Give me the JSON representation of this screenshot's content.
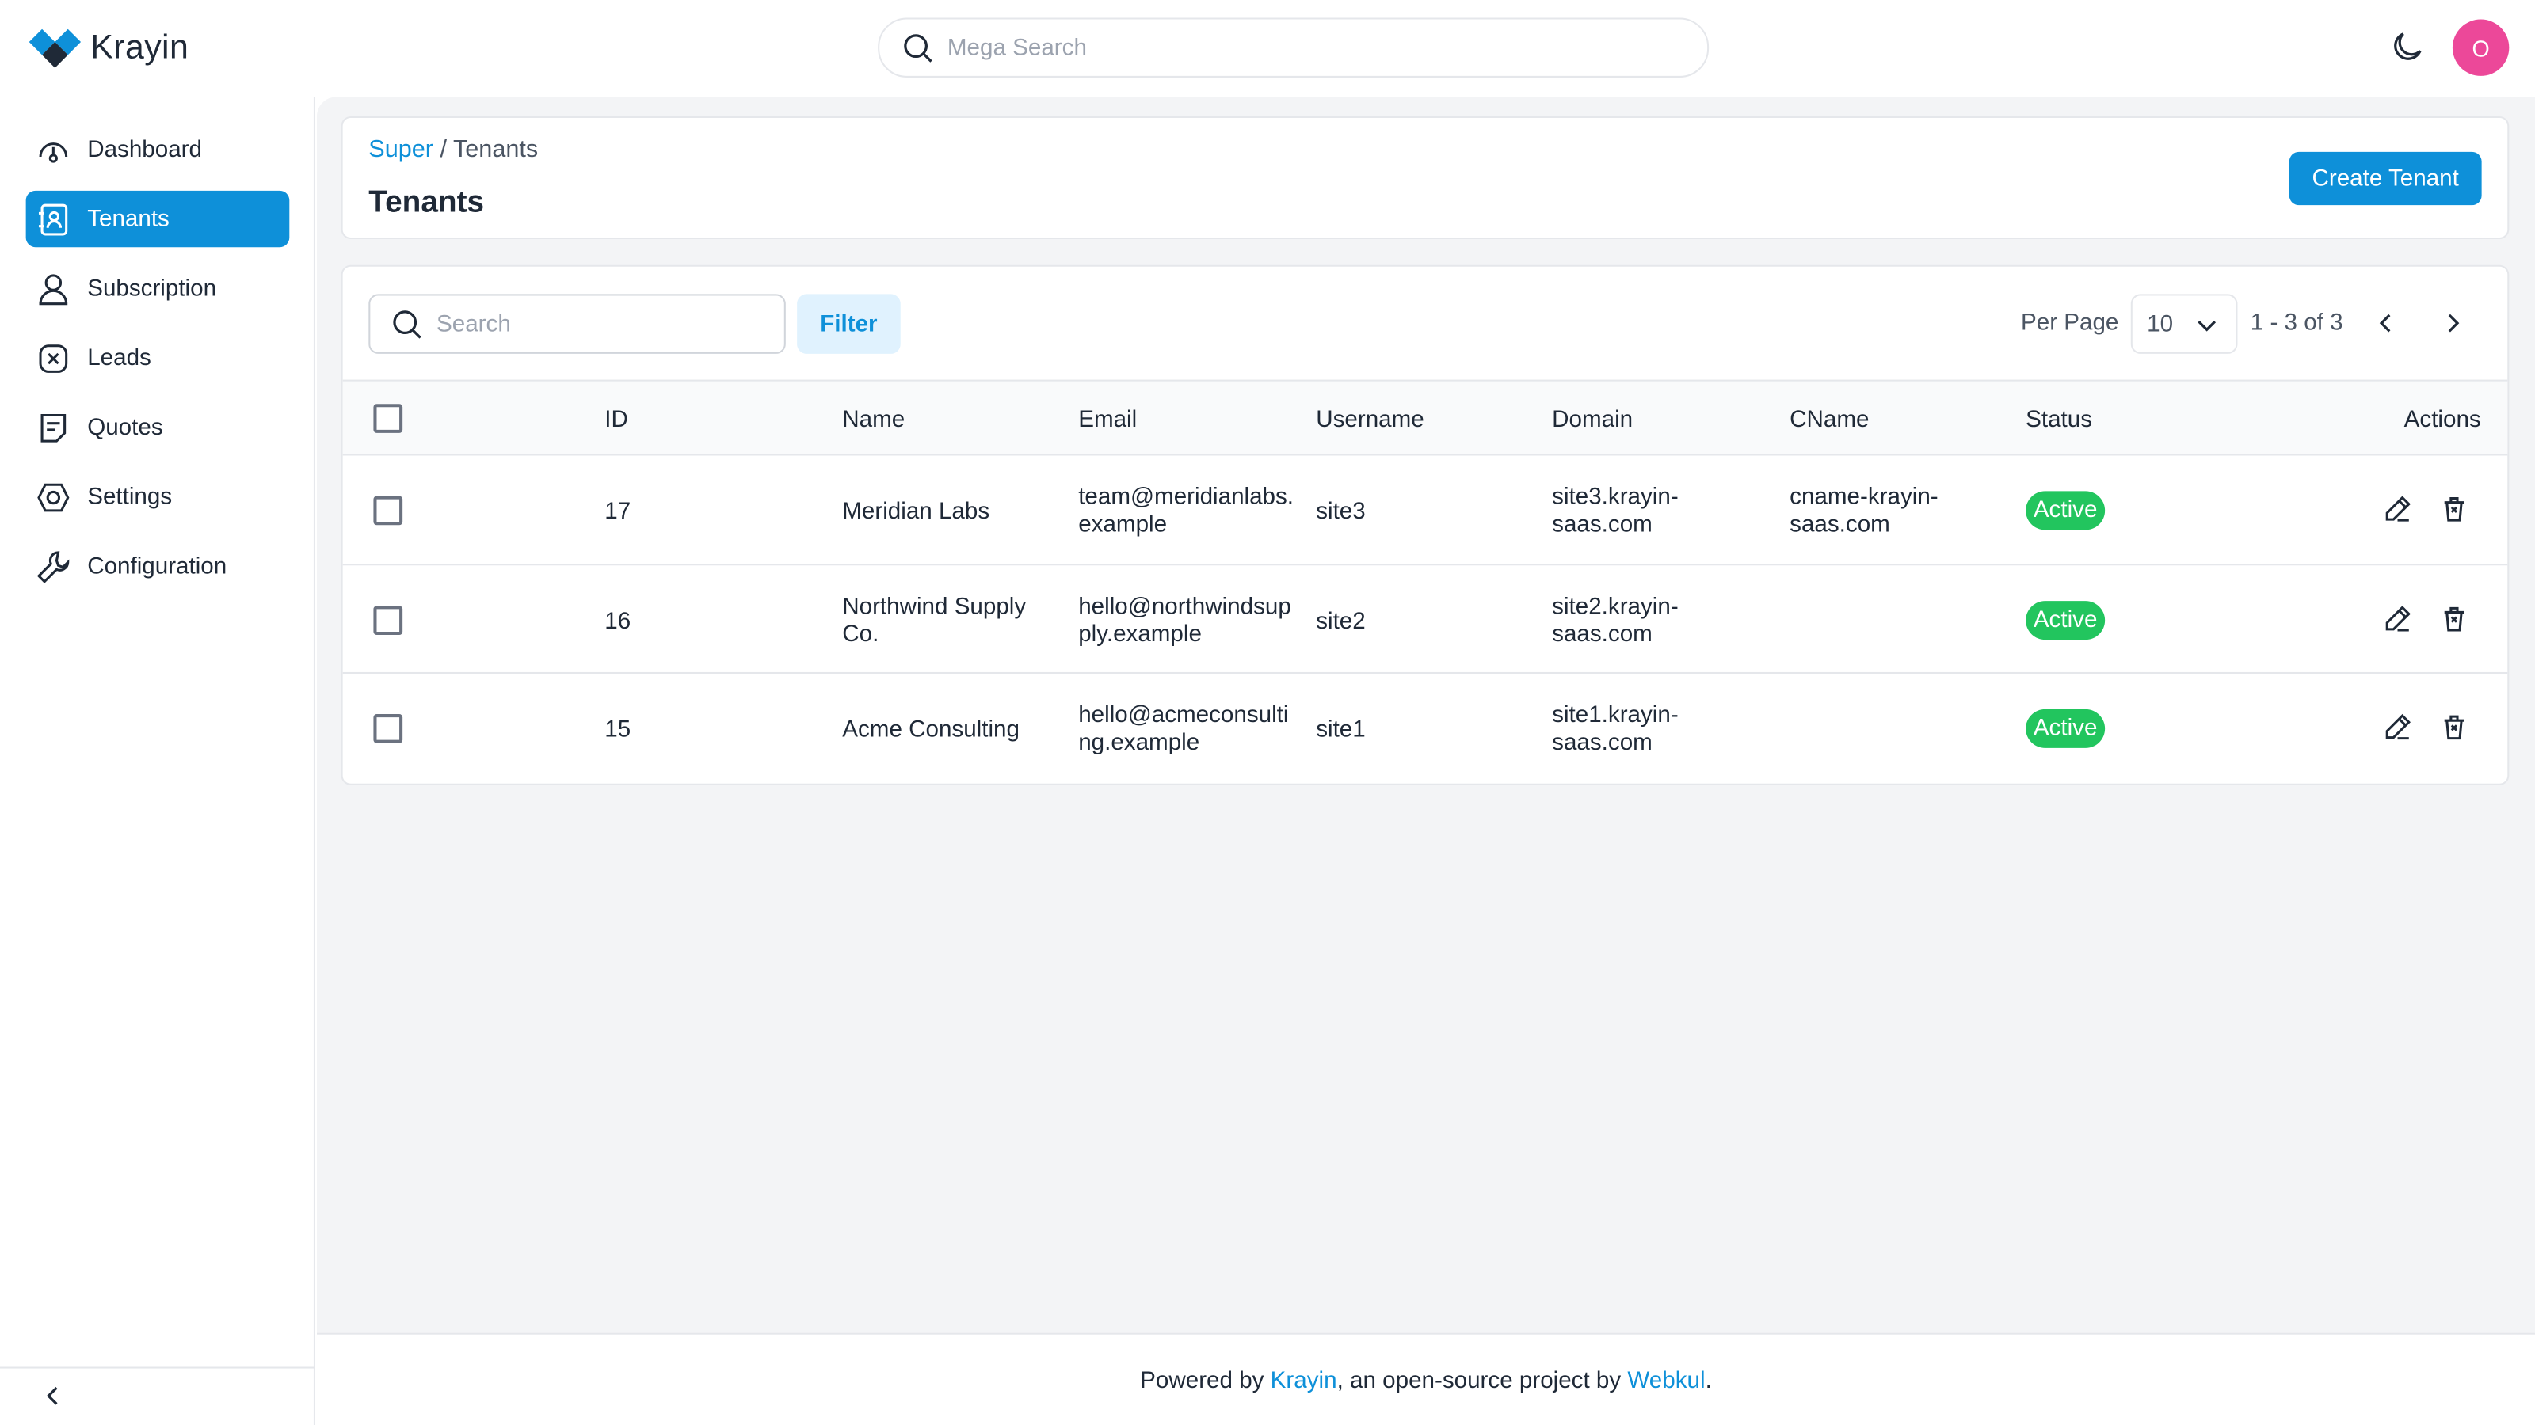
{
  "app": {
    "name": "Krayin"
  },
  "search": {
    "placeholder": "Mega Search"
  },
  "user": {
    "avatar_initial": "O",
    "avatar_color": "#ec4899"
  },
  "sidebar": {
    "items": [
      {
        "label": "Dashboard",
        "icon": "dashboard-icon"
      },
      {
        "label": "Tenants",
        "icon": "tenants-icon",
        "active": true
      },
      {
        "label": "Subscription",
        "icon": "user-icon"
      },
      {
        "label": "Leads",
        "icon": "leads-icon"
      },
      {
        "label": "Quotes",
        "icon": "quotes-icon"
      },
      {
        "label": "Settings",
        "icon": "settings-icon"
      },
      {
        "label": "Configuration",
        "icon": "wrench-icon"
      }
    ]
  },
  "breadcrumb": {
    "root": "Super",
    "separator": " / ",
    "current": "Tenants"
  },
  "page": {
    "title": "Tenants",
    "create_button": "Create Tenant"
  },
  "toolbar": {
    "search_placeholder": "Search",
    "filter_label": "Filter",
    "per_page_label": "Per Page",
    "per_page_value": "10",
    "pagination_text": "1 - 3 of 3"
  },
  "table": {
    "columns": [
      "ID",
      "Name",
      "Email",
      "Username",
      "Domain",
      "CName",
      "Status",
      "Actions"
    ],
    "rows": [
      {
        "id": "17",
        "name_l1": "Meridian Labs",
        "name_l2": "",
        "email_l1": "team@meridianlabs.",
        "email_l2": "example",
        "username": "site3",
        "domain_l1": "site3.krayin-",
        "domain_l2": "saas.com",
        "cname_l1": "cname-krayin-",
        "cname_l2": "saas.com",
        "status": "Active"
      },
      {
        "id": "16",
        "name_l1": "Northwind Supply",
        "name_l2": "Co.",
        "email_l1": "hello@northwindsup",
        "email_l2": "ply.example",
        "username": "site2",
        "domain_l1": "site2.krayin-",
        "domain_l2": "saas.com",
        "cname_l1": "",
        "cname_l2": "",
        "status": "Active"
      },
      {
        "id": "15",
        "name_l1": "Acme Consulting",
        "name_l2": "",
        "email_l1": "hello@acmeconsulti",
        "email_l2": "ng.example",
        "username": "site1",
        "domain_l1": "site1.krayin-",
        "domain_l2": "saas.com",
        "cname_l1": "",
        "cname_l2": "",
        "status": "Active"
      }
    ]
  },
  "footer": {
    "prefix": "Powered by ",
    "link1": "Krayin",
    "middle": ", an open-source project by ",
    "link2": "Webkul",
    "suffix": "."
  },
  "colors": {
    "accent": "#0e90d9",
    "status_active": "#22c55e",
    "background": "#f3f4f6"
  }
}
